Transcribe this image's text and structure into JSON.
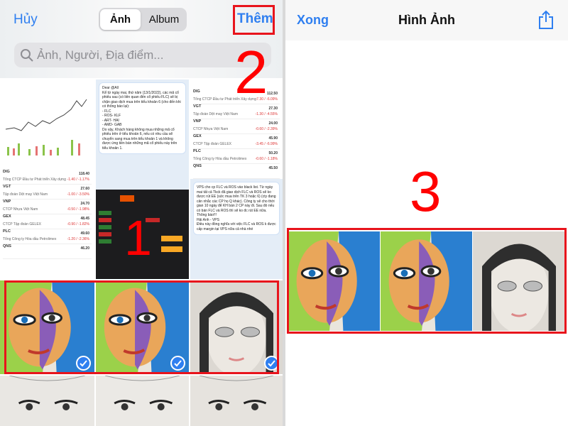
{
  "picker": {
    "cancel_label": "Hủy",
    "tabs": [
      {
        "label": "Ảnh",
        "selected": true
      },
      {
        "label": "Album",
        "selected": false
      }
    ],
    "add_label": "Thêm",
    "search_placeholder": "Ảnh, Người, Địa điểm...",
    "search_icon": "magnifier",
    "stock_rows_a": [
      {
        "code": "DIG",
        "name": "Tổng CTCP Đầu tư Phát triển Xây dựng",
        "price": "118.40",
        "change": "-1.40 / -1.17%"
      },
      {
        "code": "VGT",
        "name": "Tập đoàn Dệt may Việt Nam",
        "price": "27.60",
        "change": "-1.00 / -3.50%"
      },
      {
        "code": "VNP",
        "name": "CTCP Nhựa Việt Nam",
        "price": "24.70",
        "change": "-0.50 / -1.98%"
      },
      {
        "code": "GEX",
        "name": "CTCP Tập đoàn GELEX",
        "price": "48.45",
        "change": "-0.90 / -1.82%"
      },
      {
        "code": "PLC",
        "name": "Tổng Công ty Hóa dầu Petrolimex",
        "price": "49.60",
        "change": "-1.20 / -2.36%"
      },
      {
        "code": "QNS",
        "name": "",
        "price": "46.20",
        "change": ""
      }
    ],
    "stock_rows_b": [
      {
        "code": "DIG",
        "name": "Tổng CTCP Đầu tư Phát triển Xây dựng",
        "price": "112.50",
        "change": "-7.30 / -6.09%"
      },
      {
        "code": "VGT",
        "name": "Tập đoàn Dệt may Việt Nam",
        "price": "27.30",
        "change": "-1.30 / -4.55%"
      },
      {
        "code": "VNP",
        "name": "CTCP Nhựa Việt Nam",
        "price": "24.00",
        "change": "-0.60 / -2.39%"
      },
      {
        "code": "GEX",
        "name": "CTCP Tập đoàn GELEX",
        "price": "45.90",
        "change": "-3.45 / -6.99%"
      },
      {
        "code": "PLC",
        "name": "Tổng Công ty Hóa dầu Petrolimex",
        "price": "50.20",
        "change": "-0.60 / -1.18%"
      },
      {
        "code": "QNS",
        "name": "",
        "price": "45.50",
        "change": ""
      }
    ],
    "chat_a": [
      "Dear @All",
      "Kể từ ngày mai, thứ năm (13/1/2022), các mã cổ phiếu sau (có liên quan đến cổ phiếu FLC) sẽ bị chặn giao dịch mua trên tiểu khoản 6 (cho đến khi có thông báo lại):",
      "- FLC",
      "- ROS- KLF",
      "- ART- HAI",
      "- AMD- GAB",
      "Do vậy, Khách hàng không mua những mã cổ phiếu trên ở tiểu khoản 6, nếu có nhu cầu sẽ chuyển sang mua trên tiểu khoản 1 và không được ứng tiền bán những mã cổ phiếu này trên tiểu khoản 1."
    ],
    "chat_b": [
      "VPS cho cp FLC và ROS vào black list. Từ ngày mai tất cả Tkck đã giao dịch FLC và ROS sẽ ko được rút EE (sức mua trên TK 3 hoặc 6) (cty đang cân nhắc các CP họ Q khác). Công ty sẽ cho thời gian 10 ngày để KH bán 2 CP này đi. Sau đó nếu có bán FLC và ROS thì sẽ ko đc rút EE nữa.",
      "Thông báo!!!",
      "Hải Anh - VPS",
      "Điều này đồng nghĩa với việc FLC và ROS k được cấp margin tại VPS nữa cả nhà nhé"
    ],
    "selected_photos": 3,
    "check_icon": "checkmark-circle"
  },
  "album": {
    "done_label": "Xong",
    "title": "Hình Ảnh",
    "share_icon": "share"
  },
  "annotations": {
    "step1": "1",
    "step2": "2",
    "step3": "3"
  },
  "colors": {
    "accent": "#2f7ff0",
    "annotation": "#e8141c"
  }
}
